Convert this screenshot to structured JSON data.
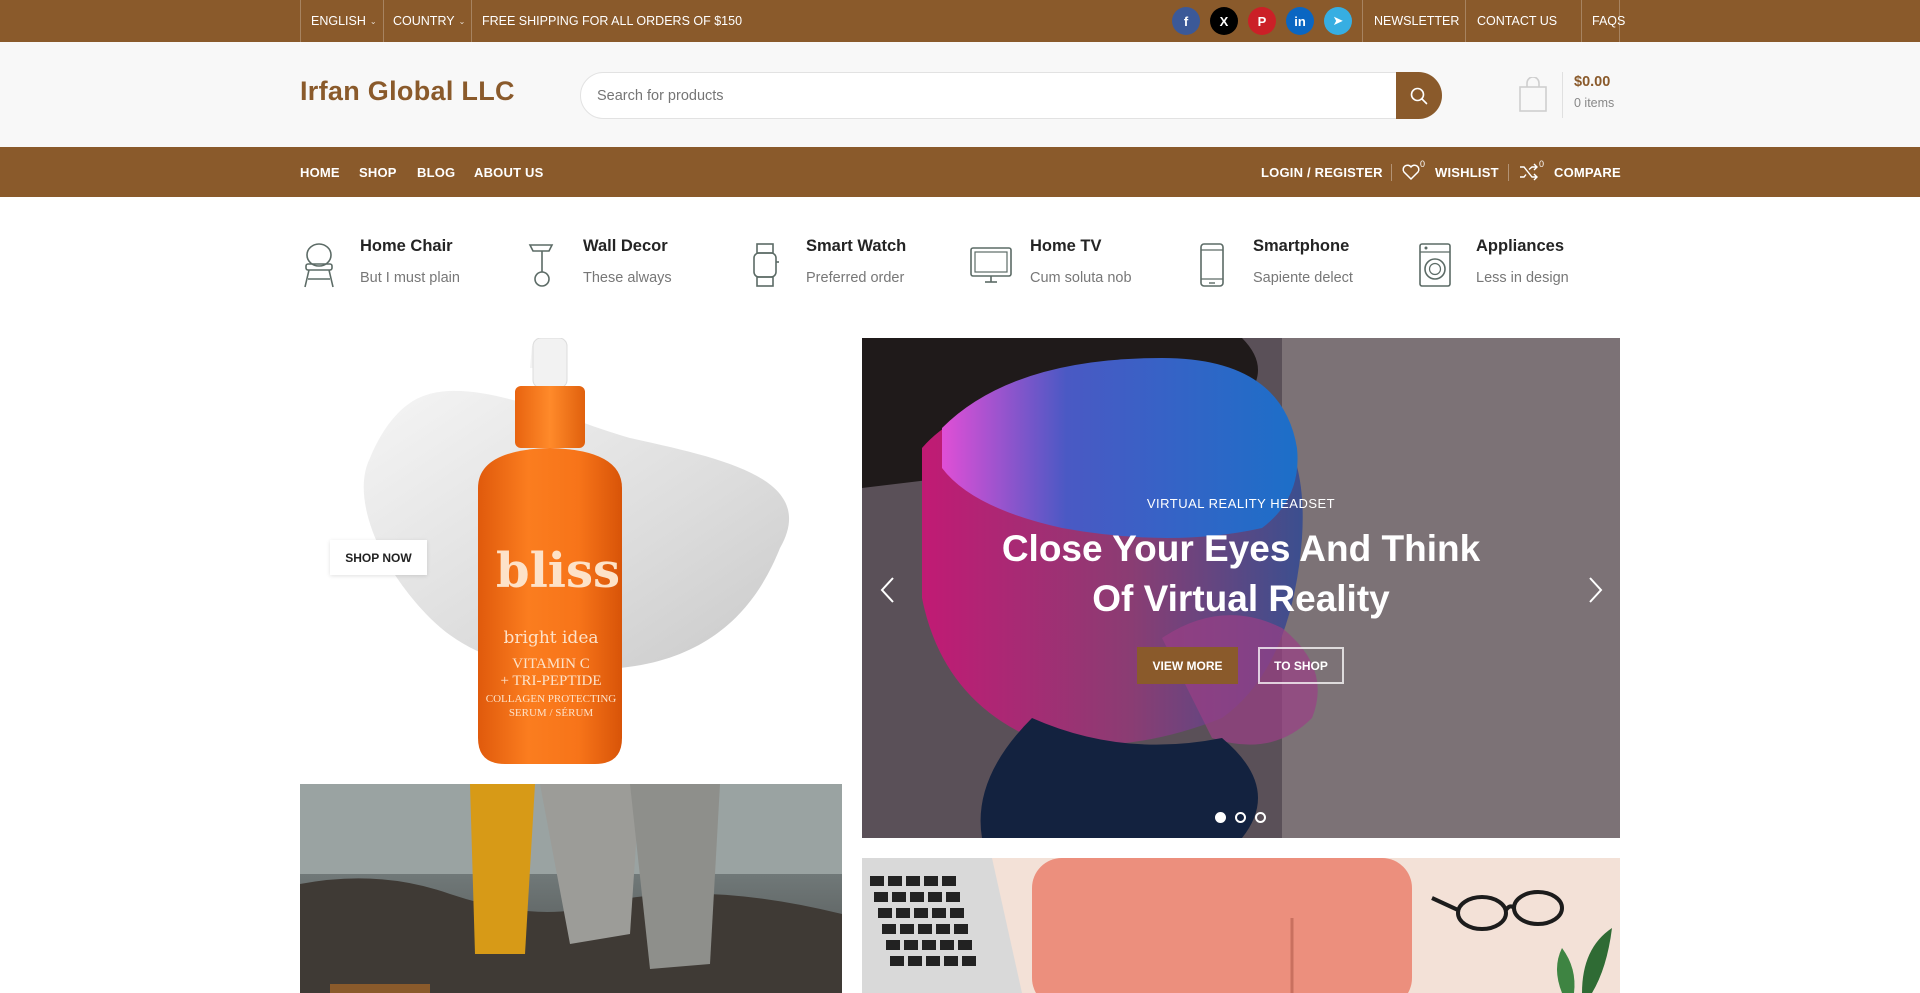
{
  "topbar": {
    "language": "ENGLISH",
    "country": "COUNTRY",
    "shipping_text": "FREE SHIPPING FOR ALL ORDERS OF $150",
    "social": [
      {
        "name": "facebook-icon",
        "glyph": "f",
        "color": "#3b5998"
      },
      {
        "name": "x-icon",
        "glyph": "X",
        "color": "#000000"
      },
      {
        "name": "pinterest-icon",
        "glyph": "P",
        "color": "#cb2027"
      },
      {
        "name": "linkedin-icon",
        "glyph": "in",
        "color": "#0a66c2"
      },
      {
        "name": "telegram-icon",
        "glyph": "➤",
        "color": "#37aee2"
      }
    ],
    "links": [
      "NEWSLETTER",
      "CONTACT US",
      "FAQS"
    ]
  },
  "header": {
    "logo": "Irfan Global LLC",
    "search_placeholder": "Search for products",
    "cart_total": "$0.00",
    "cart_items": "0 items"
  },
  "nav": {
    "main": [
      "HOME",
      "SHOP",
      "BLOG",
      "ABOUT US"
    ],
    "login": "LOGIN / REGISTER",
    "wishlist": "WISHLIST",
    "wishlist_count": "0",
    "compare": "COMPARE",
    "compare_count": "0"
  },
  "categories": [
    {
      "title": "Home Chair",
      "subtitle": "But I must plain",
      "icon": "chair-icon"
    },
    {
      "title": "Wall Decor",
      "subtitle": "These always",
      "icon": "lamp-icon"
    },
    {
      "title": "Smart Watch",
      "subtitle": "Preferred order",
      "icon": "watch-icon"
    },
    {
      "title": "Home TV",
      "subtitle": "Cum soluta nob",
      "icon": "tv-icon"
    },
    {
      "title": "Smartphone",
      "subtitle": "Sapiente delect",
      "icon": "smartphone-icon"
    },
    {
      "title": "Appliances",
      "subtitle": "Less in design",
      "icon": "washing-machine-icon"
    }
  ],
  "banner_left": {
    "shop_now": "SHOP NOW",
    "bottle_brand": "bliss",
    "bottle_line1": "bright idea",
    "bottle_line2": "VITAMIN C",
    "bottle_line3": "+ TRI-PEPTIDE",
    "bottle_line4": "COLLAGEN PROTECTING",
    "bottle_line5": "SERUM / SÉRUM"
  },
  "slider": {
    "subtitle": "VIRTUAL REALITY HEADSET",
    "title_line1": "Close Your Eyes And Think",
    "title_line2": "Of Virtual Reality",
    "btn_view_more": "VIEW MORE",
    "btn_to_shop": "TO SHOP",
    "active_slide": 1,
    "slide_count": 3
  },
  "colors": {
    "brand": "#8a5a2b",
    "header_bg": "#f8f8f8"
  }
}
